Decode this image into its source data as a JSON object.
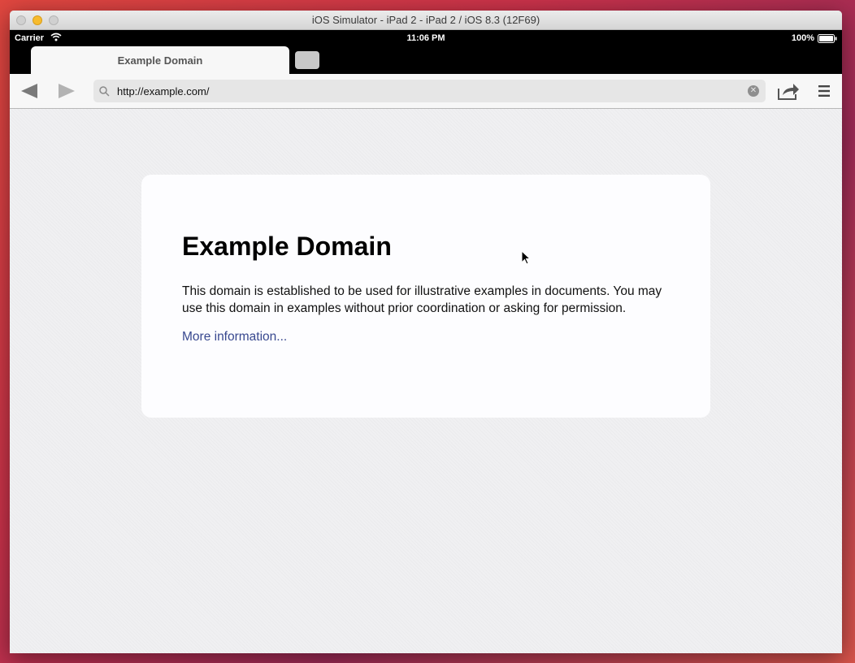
{
  "window": {
    "title": "iOS Simulator - iPad 2 - iPad 2 / iOS 8.3 (12F69)"
  },
  "status_bar": {
    "carrier": "Carrier",
    "time": "11:06 PM",
    "battery": "100%"
  },
  "tabs": [
    {
      "label": "Example Domain",
      "active": true
    }
  ],
  "address_bar": {
    "url": "http://example.com/"
  },
  "page": {
    "heading": "Example Domain",
    "body": "This domain is established to be used for illustrative examples in documents. You may use this domain in examples without prior coordination or asking for permission.",
    "link": "More information..."
  },
  "colors": {
    "link": "#38488f",
    "minimize_light": "#f7bb2e"
  },
  "icons": [
    "wifi-icon",
    "battery-icon",
    "back-arrow-icon",
    "forward-arrow-icon",
    "search-icon",
    "clear-icon",
    "share-icon",
    "menu-icon",
    "cursor-icon"
  ]
}
